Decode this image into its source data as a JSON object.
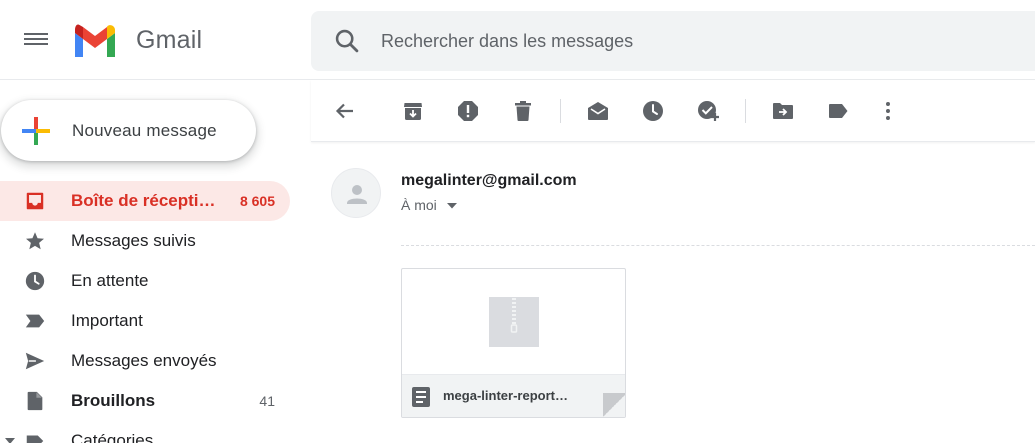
{
  "app": {
    "logo_text": "Gmail"
  },
  "search": {
    "placeholder": "Rechercher dans les messages"
  },
  "compose": {
    "label": "Nouveau message"
  },
  "nav": {
    "items": [
      {
        "label": "Boîte de récepti…",
        "count": "8 605",
        "icon": "inbox-icon"
      },
      {
        "label": "Messages suivis",
        "count": "",
        "icon": "star-icon"
      },
      {
        "label": "En attente",
        "count": "",
        "icon": "clock-icon"
      },
      {
        "label": "Important",
        "count": "",
        "icon": "important-icon"
      },
      {
        "label": "Messages envoyés",
        "count": "",
        "icon": "send-icon"
      },
      {
        "label": "Brouillons",
        "count": "41",
        "icon": "draft-icon"
      },
      {
        "label": "Catégories",
        "count": "",
        "icon": "label-icon"
      }
    ]
  },
  "toolbar": {
    "buttons": [
      "back-icon",
      "archive-icon",
      "report-spam-icon",
      "delete-icon",
      "mark-unread-icon",
      "snooze-icon",
      "add-task-icon",
      "move-to-icon",
      "labels-icon",
      "more-icon"
    ]
  },
  "message": {
    "sender": "megalinter@gmail.com",
    "recipient": "À moi"
  },
  "attachment": {
    "name": "mega-linter-report…"
  },
  "colors": {
    "accent": "#d93025",
    "active_bg": "#fce8e6",
    "search_bg": "#f1f3f4",
    "icon_gray": "#5f6368"
  }
}
